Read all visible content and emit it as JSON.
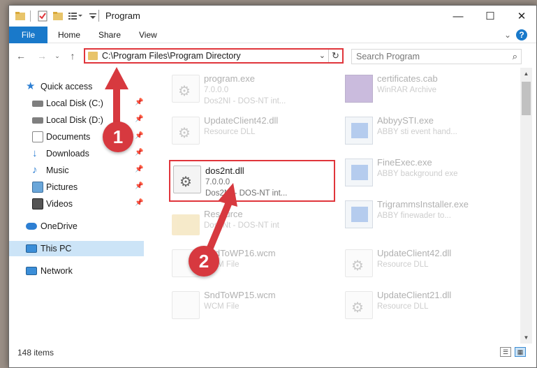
{
  "window": {
    "title": "Program"
  },
  "ribbon": {
    "tabs": [
      "File",
      "Home",
      "Share",
      "View"
    ]
  },
  "address": {
    "path": "C:\\Program Files\\Program Directory"
  },
  "search": {
    "placeholder": "Search Program"
  },
  "sidebar": {
    "items": [
      {
        "label": "Quick access",
        "icon": "star-icon"
      },
      {
        "label": "Local Disk (C:)",
        "icon": "drive-icon"
      },
      {
        "label": "Local Disk (D:)",
        "icon": "drive-icon"
      },
      {
        "label": "Documents",
        "icon": "documents-icon"
      },
      {
        "label": "Downloads",
        "icon": "download-icon"
      },
      {
        "label": "Music",
        "icon": "music-icon"
      },
      {
        "label": "Pictures",
        "icon": "pictures-icon"
      },
      {
        "label": "Videos",
        "icon": "videos-icon"
      },
      {
        "label": "OneDrive",
        "icon": "cloud-icon"
      },
      {
        "label": "This PC",
        "icon": "computer-icon"
      },
      {
        "label": "Network",
        "icon": "network-icon"
      }
    ]
  },
  "files": [
    {
      "name": "program.exe",
      "version": "7.0.0.0",
      "desc": "Dos2NI - DOS-NT int...",
      "icon": "app-icon"
    },
    {
      "name": "certificates.cab",
      "version": "WinRAR Archive",
      "desc": "",
      "icon": "archive-icon"
    },
    {
      "name": "UpdateClient42.dll",
      "version": "Resource DLL",
      "desc": "",
      "icon": "dll-icon"
    },
    {
      "name": "AbbyySTI.exe",
      "version": "ABBY sti event hand...",
      "desc": "",
      "icon": "exe-icon"
    },
    {
      "name": "dos2nt.dll",
      "version": "7.0.0.0",
      "desc": "Dos2Nt - DOS-NT int...",
      "icon": "dll-icon"
    },
    {
      "name": "FineExec.exe",
      "version": "ABBY background exe",
      "desc": "",
      "icon": "exe-icon"
    },
    {
      "name": "Resource",
      "version": "Dos2Nt - DOS-NT int",
      "desc": "",
      "icon": "folder-icon"
    },
    {
      "name": "TrigrammsInstaller.exe",
      "version": "ABBY finewader to...",
      "desc": "",
      "icon": "exe-icon"
    },
    {
      "name": "SndToWP16.wcm",
      "version": "WCM File",
      "desc": "",
      "icon": "file-icon"
    },
    {
      "name": "UpdateClient42.dll",
      "version": "Resource DLL",
      "desc": "",
      "icon": "dll-icon"
    },
    {
      "name": "SndToWP15.wcm",
      "version": "WCM File",
      "desc": "",
      "icon": "file-icon"
    },
    {
      "name": "UpdateClient21.dll",
      "version": "Resource DLL",
      "desc": "",
      "icon": "dll-icon"
    }
  ],
  "status": {
    "items_count": "148 items"
  },
  "annotations": {
    "step1": "1",
    "step2": "2",
    "accent": "#e0353b"
  }
}
